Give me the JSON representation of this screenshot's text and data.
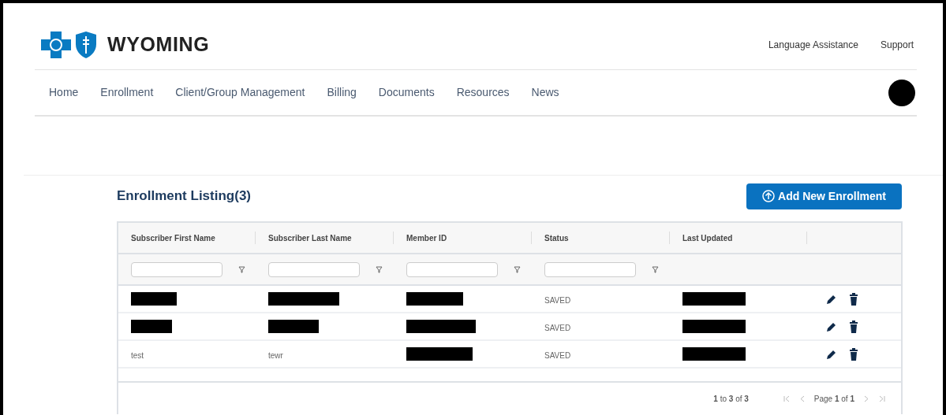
{
  "header": {
    "brand": "WYOMING",
    "utility_links": [
      "Language Assistance",
      "Support"
    ]
  },
  "nav": {
    "items": [
      "Home",
      "Enrollment",
      "Client/Group Management",
      "Billing",
      "Documents",
      "Resources",
      "News"
    ]
  },
  "listing": {
    "title": "Enrollment Listing(3)",
    "add_button": "Add New Enrollment",
    "table": {
      "columns": [
        {
          "label": "Subscriber First Name",
          "filter": true
        },
        {
          "label": "Subscriber Last Name",
          "filter": true
        },
        {
          "label": "Member ID",
          "filter": true
        },
        {
          "label": "Status",
          "filter": true
        },
        {
          "label": "Last Updated",
          "filter": false
        }
      ],
      "rows": [
        {
          "cells": [
            {
              "redacted": true
            },
            {
              "redacted": true
            },
            {
              "redacted": true
            },
            {
              "text": "SAVED"
            },
            {
              "redacted": true
            }
          ]
        },
        {
          "cells": [
            {
              "redacted": true
            },
            {
              "redacted": true
            },
            {
              "redacted": true
            },
            {
              "text": "SAVED"
            },
            {
              "redacted": true
            }
          ]
        },
        {
          "cells": [
            {
              "text": "test"
            },
            {
              "text": "tewr"
            },
            {
              "redacted": true
            },
            {
              "text": "SAVED"
            },
            {
              "redacted": true
            }
          ]
        }
      ]
    },
    "pagination": {
      "summary": "**1** to **3** of **3**",
      "page": "Page **1** of **1**"
    }
  }
}
